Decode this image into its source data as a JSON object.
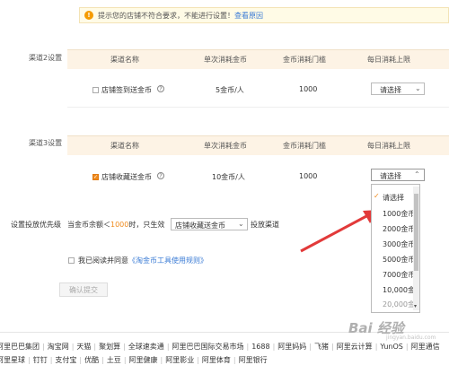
{
  "warning": {
    "text": "提示您的店铺不符合要求，不能进行设置！",
    "link": "查看原因"
  },
  "columns": {
    "channel_name": "渠道名称",
    "single_cost": "单次消耗金币",
    "cost_threshold": "金币消耗门槛",
    "daily_limit": "每日消耗上限"
  },
  "channel2": {
    "label": "渠道2设置",
    "name": "店铺签到送金币",
    "checked": false,
    "single_cost": "5金币/人",
    "threshold": "1000",
    "select_value": "请选择"
  },
  "channel3": {
    "label": "渠道3设置",
    "name": "店铺收藏送金币",
    "checked": true,
    "single_cost": "10金币/人",
    "threshold": "1000",
    "select_value": "请选择"
  },
  "dropdown": {
    "options": [
      "请选择",
      "1000金币",
      "2000金币",
      "3000金币",
      "5000金币",
      "7000金币",
      "10,000金",
      "20,000金"
    ],
    "selected_index": 0,
    "checkmark": "✓"
  },
  "priority": {
    "label": "设置投放优先级",
    "text_before": "当金币余额＜",
    "amount": "1000",
    "text_middle": "时，只生效",
    "select_value": "店铺收藏送金币",
    "text_after": "投放渠道"
  },
  "agreement": {
    "text": "我已阅读并同意",
    "link": "《淘金币工具使用规则》",
    "checked": false
  },
  "submit_label": "确认提交",
  "footer": {
    "row1": [
      "阿里巴巴集团",
      "淘宝网",
      "天猫",
      "聚划算",
      "全球速卖通",
      "阿里巴巴国际交易市场",
      "1688",
      "阿里妈妈",
      "飞猪",
      "阿里云计算",
      "YunOS",
      "阿里通信"
    ],
    "row2": [
      "阿里星球",
      "钉钉",
      "支付宝",
      "优酷",
      "土豆",
      "阿里健康",
      "阿里影业",
      "阿里体育",
      "阿里银行"
    ]
  },
  "watermark": {
    "main": "Bai 经验",
    "sub": "jingyan.baidu.com"
  },
  "colors": {
    "accent": "#f08a1c",
    "link": "#3a7bd5",
    "header_bg": "#fdf3e5",
    "arrow": "#e23a3a"
  }
}
